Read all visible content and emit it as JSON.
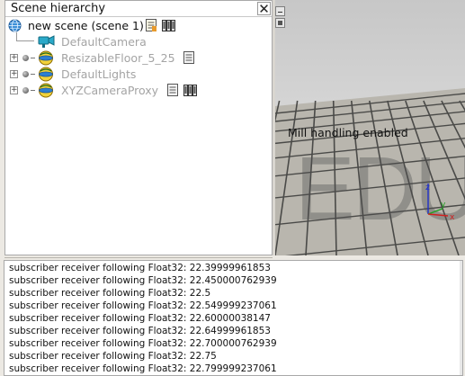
{
  "hierarchy": {
    "title": "Scene hierarchy",
    "close_glyph": "✕",
    "root": {
      "label": "new scene (scene 1)",
      "icon": "globe-icon"
    },
    "items": [
      {
        "label": "DefaultCamera",
        "icon": "camera-icon",
        "expandable": false
      },
      {
        "label": "ResizableFloor_5_25",
        "icon": "dummy-object-icon",
        "expandable": true,
        "expand_glyph": "+"
      },
      {
        "label": "DefaultLights",
        "icon": "dummy-object-icon",
        "expandable": true,
        "expand_glyph": "+"
      },
      {
        "label": "XYZCameraProxy",
        "icon": "dummy-object-icon",
        "expandable": true,
        "expand_glyph": "+"
      }
    ]
  },
  "viewport": {
    "message": "Mill handling enabled",
    "watermark": "EDU",
    "axes": {
      "x": "x",
      "y": "y",
      "z": "z"
    },
    "axis_colors": {
      "x": "#d02020",
      "y": "#20a020",
      "z": "#2030c8"
    }
  },
  "console": {
    "lines": [
      "subscriber receiver following Float32: 22.39999961853",
      "subscriber receiver following Float32: 22.450000762939",
      "subscriber receiver following Float32: 22.5",
      "subscriber receiver following Float32: 22.549999237061",
      "subscriber receiver following Float32: 22.60000038147",
      "subscriber receiver following Float32: 22.64999961853",
      "subscriber receiver following Float32: 22.700000762939",
      "subscriber receiver following Float32: 22.75",
      "subscriber receiver following Float32: 22.799999237061"
    ]
  },
  "colors": {
    "window_bg": "#ece9e3",
    "panel_bg": "#ffffff",
    "disabled_text": "#a4a4a4",
    "floor_tile": "#b9b6ae",
    "floor_grout": "#4a4a48"
  }
}
